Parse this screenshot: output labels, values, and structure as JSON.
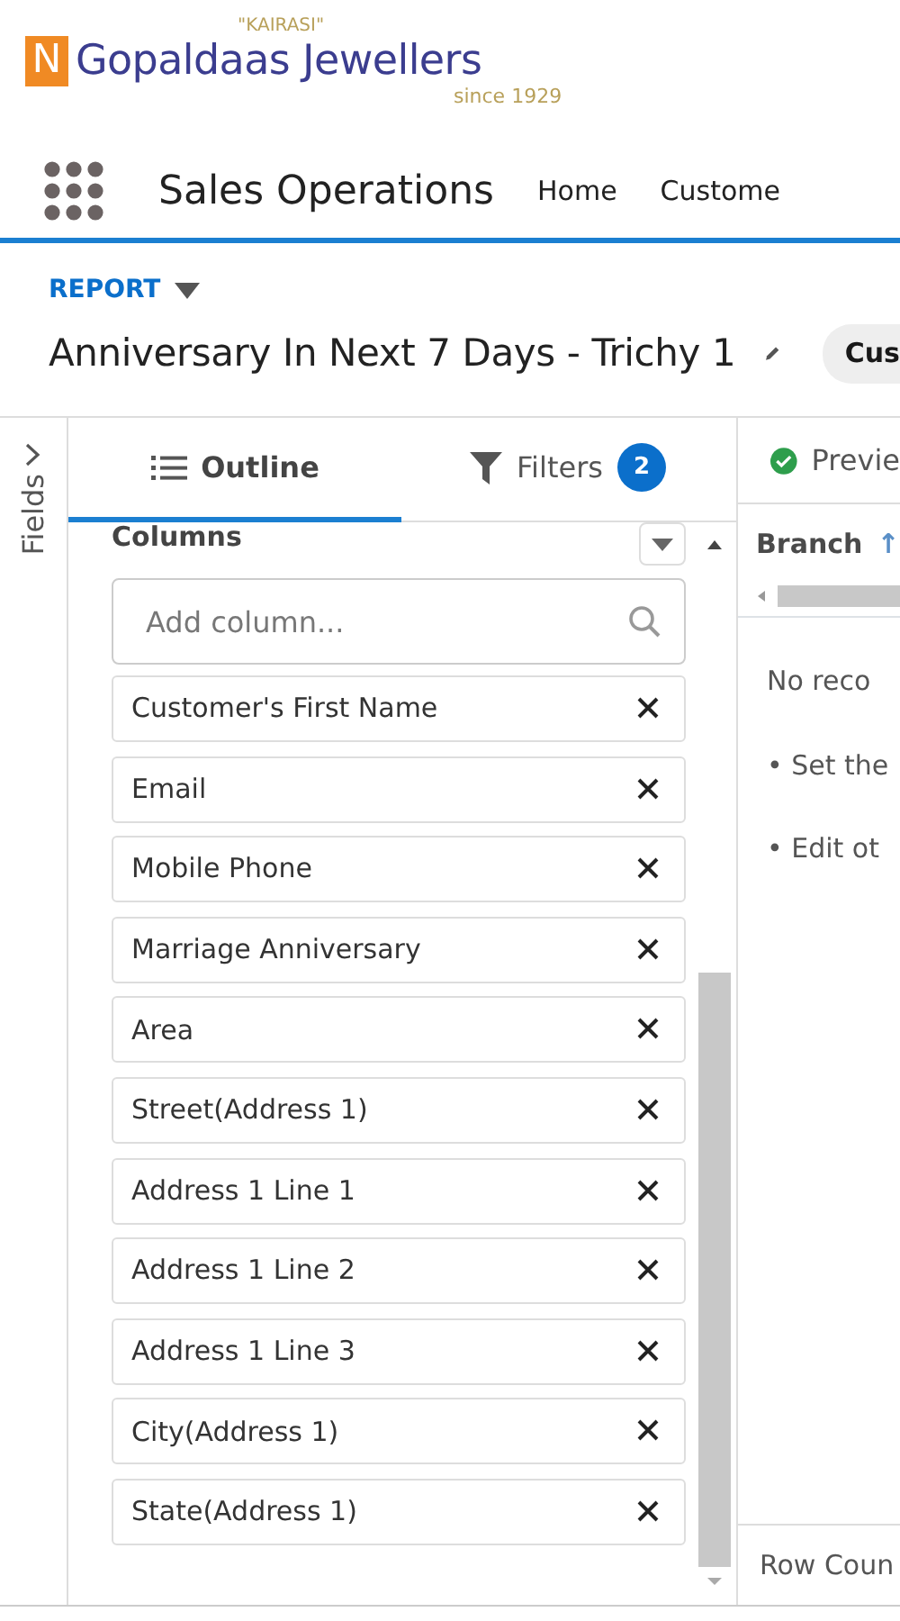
{
  "brand": {
    "tagline": "\"KAIRASI\"",
    "logo_letter": "N",
    "name": "Gopaldaas Jewellers",
    "since": "since 1929"
  },
  "app_nav": {
    "app_name": "Sales Operations",
    "items": [
      {
        "label": "Home",
        "selected": false
      },
      {
        "label": "Custome",
        "selected": false
      }
    ]
  },
  "report": {
    "type_label": "REPORT",
    "title": "Anniversary In Next 7 Days - Trichy 1",
    "chip": "Cus"
  },
  "fields_panel": {
    "label": "Fields"
  },
  "tabs": [
    {
      "label": "Outline",
      "selected": true,
      "kind": "outline"
    },
    {
      "label": "Filters",
      "selected": false,
      "kind": "filters",
      "count": "2"
    }
  ],
  "columns": {
    "heading": "Columns",
    "search": {
      "placeholder": "Add column..."
    },
    "items": [
      {
        "label": "Customer's First Name"
      },
      {
        "label": "Email"
      },
      {
        "label": "Mobile Phone"
      },
      {
        "label": "Marriage Anniversary"
      },
      {
        "label": "Area"
      },
      {
        "label": "Street(Address 1)"
      },
      {
        "label": "Address 1 Line 1"
      },
      {
        "label": "Address 1 Line 2"
      },
      {
        "label": "Address 1 Line 3"
      },
      {
        "label": "City(Address 1)"
      },
      {
        "label": "State(Address 1)"
      }
    ]
  },
  "preview": {
    "toggle": "Previe",
    "column_header": "Branch",
    "arrow": "↑",
    "empty_message": "No reco",
    "hints": [
      "• Set the",
      "• Edit ot"
    ],
    "footer": "Row Coun"
  }
}
